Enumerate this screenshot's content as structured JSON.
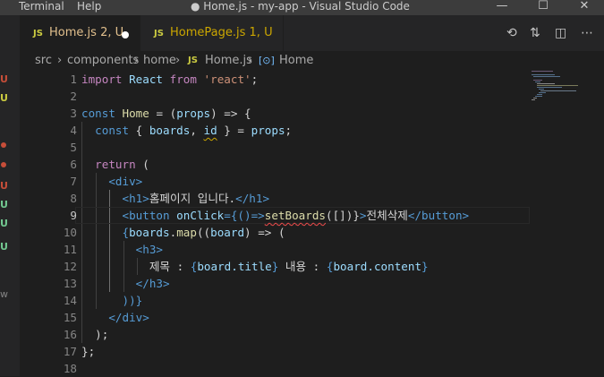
{
  "titlebar": {
    "menu": [
      "Terminal",
      "Help"
    ],
    "title": "● Home.js - my-app - Visual Studio Code",
    "controls": [
      "minimize",
      "maximize",
      "close"
    ]
  },
  "activity": {
    "git_letters": [
      "U",
      "U",
      "U",
      "U",
      "U",
      "U"
    ],
    "other": "w"
  },
  "tabs": [
    {
      "icon": "JS",
      "name": "Home.js",
      "status": "2, U",
      "dirty": true,
      "active": true
    },
    {
      "icon": "JS",
      "name": "HomePage.js",
      "status": "1, U",
      "dirty": false,
      "active": false
    }
  ],
  "toolbar_icons": [
    "timeline-icon",
    "compare-changes-icon",
    "split-editor-icon",
    "more-actions-icon"
  ],
  "breadcrumb": {
    "parts": [
      "src",
      "components",
      "home",
      "Home.js",
      "Home"
    ],
    "file_icon": "JS",
    "symbol_icon": "[⊙]"
  },
  "editor": {
    "current_line": "9",
    "line_numbers": [
      "1",
      "2",
      "3",
      "4",
      "5",
      "6",
      "7",
      "8",
      "9",
      "10",
      "11",
      "12",
      "13",
      "14",
      "15",
      "16",
      "17",
      "18"
    ],
    "text": {
      "t1_import": "import",
      "t1_react": "React",
      "t1_from": "from",
      "t1_str": "'react'",
      "t1_semi": ";",
      "t3_const": "const",
      "t3_home": "Home",
      "t3_eq": " = (",
      "t3_props": "props",
      "t3_arrow": ") => {",
      "t4_const": "const",
      "t4_open": " { ",
      "t4_boards": "boards",
      "t4_comma": ", ",
      "t4_id": "id",
      "t4_close": " } = ",
      "t4_props": "props",
      "t4_semi": ";",
      "t6_return": "return",
      "t6_paren": " (",
      "t7_div": "<div>",
      "t8_open": "<h1>",
      "t8_text": "홈페이지 입니다.",
      "t8_close": "</h1>",
      "t9_open": "<button",
      "t9_attr": "onClick",
      "t9_eq": "={()=>",
      "t9_fn": "setBoards",
      "t9_args": "([])}",
      "t9_gt": ">",
      "t9_text": "전체삭제",
      "t9_close": "</button>",
      "t10_brace": "{",
      "t10_boards": "boards",
      "t10_dot": ".",
      "t10_map": "map",
      "t10_paren": "((",
      "t10_board": "board",
      "t10_arrow": ") => (",
      "t11_open": "<h3>",
      "t12_label1": "제목 : ",
      "t12_b1": "{",
      "t12_expr1": "board.title",
      "t12_b2": "}",
      "t12_label2": " 내용 : ",
      "t12_b3": "{",
      "t12_expr2": "board.content",
      "t12_b4": "}",
      "t13_close": "</h3>",
      "t14_close": "))}",
      "t15_close": "</div>",
      "t16_close": ");",
      "t17_close": "};"
    }
  },
  "colors": {
    "keyword": "#569cd6",
    "control": "#c586c0",
    "string": "#ce9178",
    "variable": "#9cdcfe",
    "component": "#4ec9b0",
    "function": "#dcdcaa",
    "error_squiggle": "#f14c4c",
    "warning_squiggle": "#cca700",
    "modified_tab": "#e2c08d"
  }
}
